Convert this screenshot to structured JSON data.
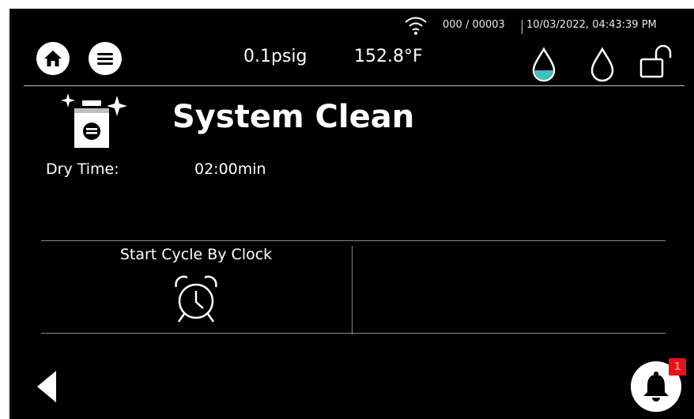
{
  "status_bar": {
    "cycle_counter": "000 / 00003",
    "datetime": "10/03/2022, 04:43:39 PM",
    "icons": [
      "wifi-icon"
    ]
  },
  "header": {
    "pressure": "0.1psig",
    "temperature": "152.8°F",
    "left_buttons": [
      "home-icon",
      "menu-icon"
    ],
    "right_icons": [
      "water-drop-filled-icon",
      "water-drop-outline-icon",
      "unlocked-padlock-icon"
    ],
    "accent_color": "#3cc0c4"
  },
  "main": {
    "title": "System Clean",
    "program_icon": "system-clean-icon",
    "dry_time_label": "Dry Time:",
    "dry_time_value": "02:00min"
  },
  "options": {
    "start_cycle_label": "Start Cycle By Clock",
    "start_cycle_icon": "alarm-clock-icon"
  },
  "footer": {
    "back_icon": "back-arrow-icon",
    "bell_icon": "bell-icon",
    "notification_count": "1",
    "badge_color": "#e0141a"
  }
}
